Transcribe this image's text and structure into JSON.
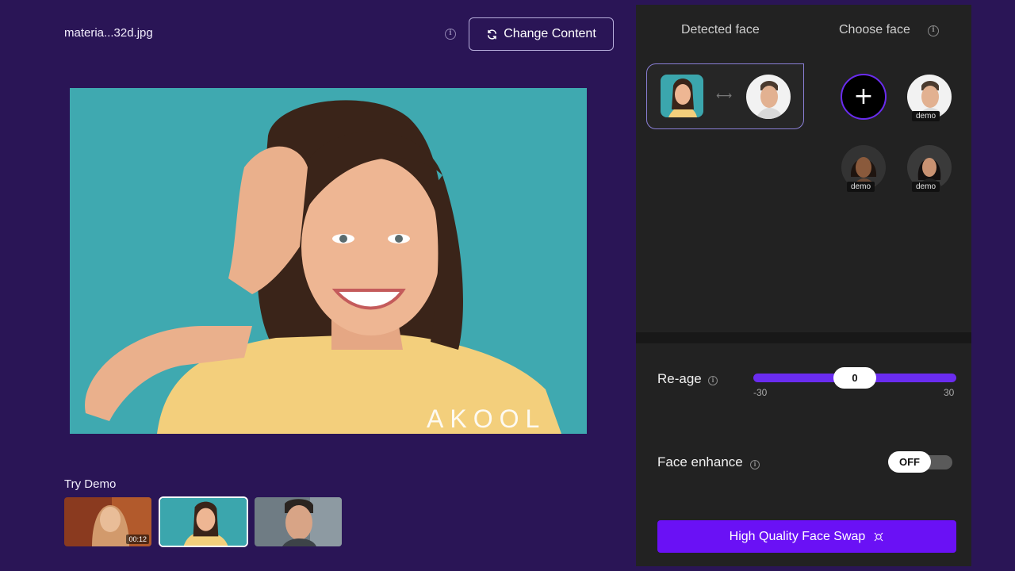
{
  "header": {
    "filename": "materia...32d.jpg",
    "change_content_label": "Change Content"
  },
  "watermark": "AKOOL",
  "try_demo": {
    "label": "Try Demo",
    "items": [
      {
        "name": "demo-video-woman",
        "duration": "00:12",
        "selected": false
      },
      {
        "name": "demo-photo-smiling-woman",
        "duration": "",
        "selected": true
      },
      {
        "name": "demo-photo-man",
        "duration": "",
        "selected": false
      }
    ]
  },
  "panel": {
    "detected_face_header": "Detected face",
    "choose_face_header": "Choose face",
    "add_face_symbol": "+",
    "choose_faces": [
      {
        "label": "demo"
      },
      {
        "label": "demo"
      },
      {
        "label": "demo"
      }
    ]
  },
  "controls": {
    "reage": {
      "label": "Re-age",
      "value": "0",
      "min": "-30",
      "max": "30"
    },
    "face_enhance": {
      "label": "Face enhance",
      "state": "OFF"
    },
    "swap_button_label": "High Quality Face Swap"
  },
  "colors": {
    "background": "#2a1556",
    "panel": "#222222",
    "accent": "#6a2cf0",
    "button": "#6a11f5"
  },
  "icons": {
    "info": "info-icon",
    "refresh": "refresh-icon",
    "swap_arrow": "arrow-left-right-icon",
    "add": "plus-icon",
    "sparkle": "sparkle-icon"
  }
}
